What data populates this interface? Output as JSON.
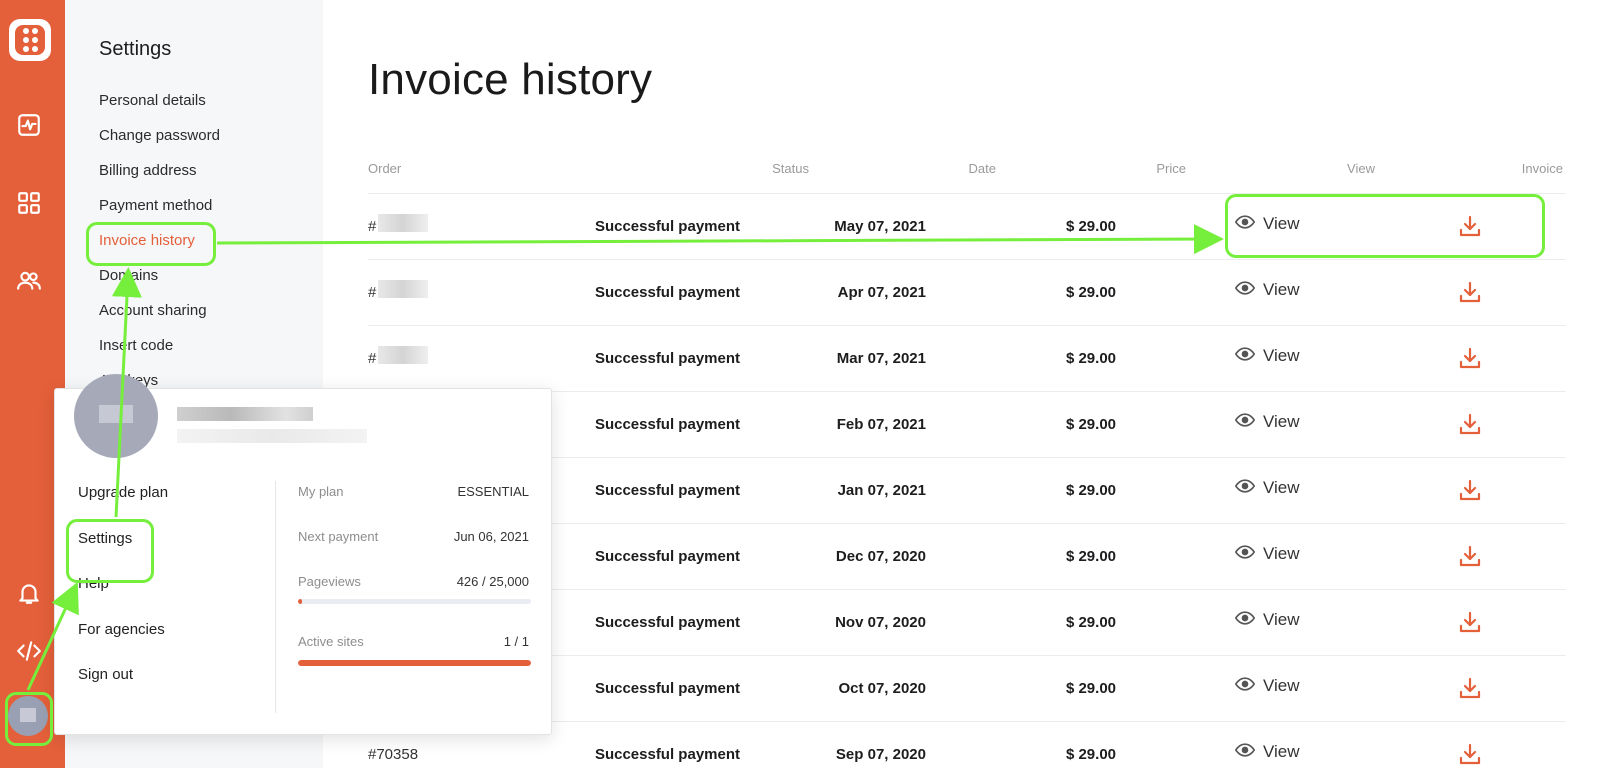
{
  "rail": {
    "icons": [
      "app-logo-icon",
      "activity-icon",
      "dashboard-grid-icon",
      "users-icon",
      "bell-icon",
      "code-icon",
      "avatar"
    ]
  },
  "settings": {
    "title": "Settings",
    "items": [
      {
        "label": "Personal details"
      },
      {
        "label": "Change password"
      },
      {
        "label": "Billing address"
      },
      {
        "label": "Payment method"
      },
      {
        "label": "Invoice history",
        "active": true
      },
      {
        "label": "Domains"
      },
      {
        "label": "Account sharing"
      },
      {
        "label": "Insert code"
      },
      {
        "label": "API keys"
      }
    ]
  },
  "main": {
    "title": "Invoice history",
    "columns": {
      "order": "Order",
      "status": "Status",
      "date": "Date",
      "price": "Price",
      "view": "View",
      "invoice": "Invoice"
    },
    "rows": [
      {
        "order": "#",
        "status": "Successful payment",
        "date": "May 07, 2021",
        "price": "$ 29.00",
        "view": "View"
      },
      {
        "order": "#",
        "status": "Successful payment",
        "date": "Apr 07, 2021",
        "price": "$ 29.00",
        "view": "View"
      },
      {
        "order": "#",
        "status": "Successful payment",
        "date": "Mar 07, 2021",
        "price": "$ 29.00",
        "view": "View"
      },
      {
        "order": "",
        "status": "Successful payment",
        "date": "Feb 07, 2021",
        "price": "$ 29.00",
        "view": "View"
      },
      {
        "order": "",
        "status": "Successful payment",
        "date": "Jan 07, 2021",
        "price": "$ 29.00",
        "view": "View"
      },
      {
        "order": "",
        "status": "Successful payment",
        "date": "Dec 07, 2020",
        "price": "$ 29.00",
        "view": "View"
      },
      {
        "order": "",
        "status": "Successful payment",
        "date": "Nov 07, 2020",
        "price": "$ 29.00",
        "view": "View"
      },
      {
        "order": "",
        "status": "Successful payment",
        "date": "Oct 07, 2020",
        "price": "$ 29.00",
        "view": "View"
      },
      {
        "order": "#70358",
        "status": "Successful payment",
        "date": "Sep 07, 2020",
        "price": "$ 29.00",
        "view": "View"
      }
    ]
  },
  "popup": {
    "menu": [
      "Upgrade plan",
      "Settings",
      "Help",
      "For agencies",
      "Sign out"
    ],
    "stats": {
      "plan_label": "My plan",
      "plan_value": "ESSENTIAL",
      "next_payment_label": "Next payment",
      "next_payment_value": "Jun 06, 2021",
      "pageviews_label": "Pageviews",
      "pageviews_value": "426 / 25,000",
      "pageviews_fraction": 0.017,
      "active_sites_label": "Active sites",
      "active_sites_value": "1 / 1",
      "active_sites_fraction": 1.0
    }
  },
  "colors": {
    "accent": "#e4603a",
    "highlight": "#76ee3c"
  }
}
